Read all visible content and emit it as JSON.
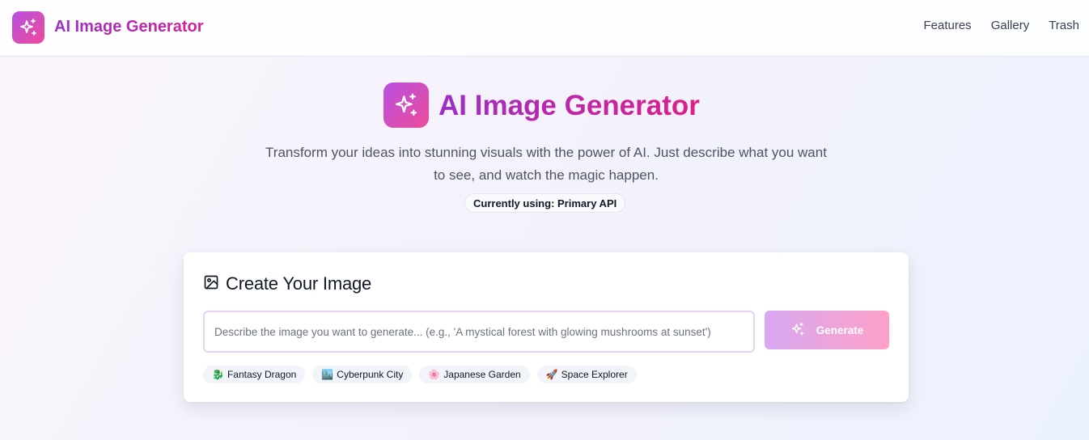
{
  "app": {
    "title": "AI Image Generator"
  },
  "nav": {
    "links": [
      "Features",
      "Gallery",
      "Trash"
    ]
  },
  "hero": {
    "title": "AI Image Generator",
    "subtitle": "Transform your ideas into stunning visuals with the power of AI. Just describe what you want to see, and watch the magic happen.",
    "api_badge": "Currently using: Primary API"
  },
  "card": {
    "title": "Create Your Image",
    "icon": "image-icon",
    "prompt": {
      "value": "",
      "placeholder": "Describe the image you want to generate... (e.g., 'A mystical forest with glowing mushrooms at sunset')"
    },
    "generate_label": "Generate",
    "examples": [
      {
        "icon": "🐉",
        "label": "Fantasy Dragon"
      },
      {
        "icon": "🏙️",
        "label": "Cyberpunk City"
      },
      {
        "icon": "🌸",
        "label": "Japanese Garden"
      },
      {
        "icon": "🚀",
        "label": "Space Explorer"
      }
    ]
  },
  "colors": {
    "brand_gradient_start": "#b84fe0",
    "brand_gradient_end": "#ec4c9a",
    "title_gradient_start": "#9b2fc6",
    "title_gradient_end": "#e01e8a",
    "generate_button_start": "#d9a8f2",
    "generate_button_end": "#fda0c8"
  }
}
